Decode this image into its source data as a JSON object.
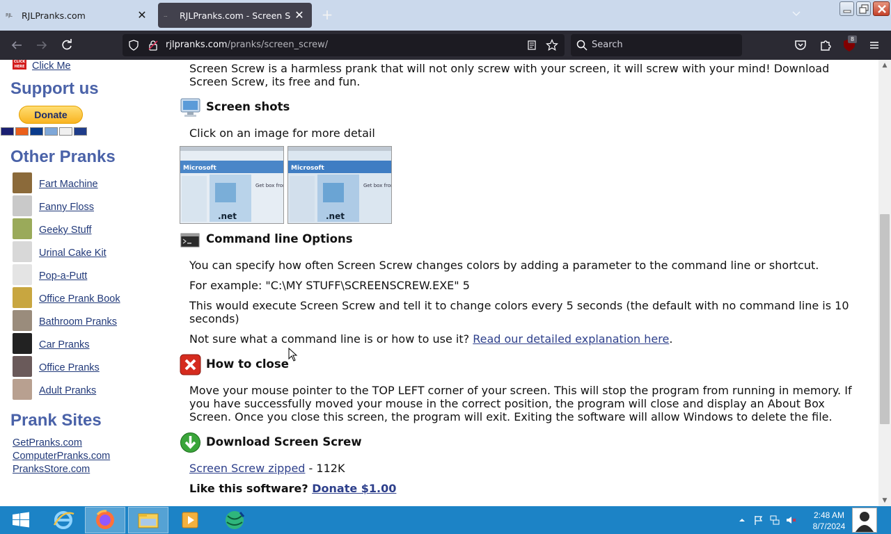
{
  "browser": {
    "tabs": [
      {
        "favicon_text": "RJL",
        "title": "RJLPranks.com"
      },
      {
        "favicon_text": "...",
        "title": "RJLPranks.com - Screen Screw"
      }
    ],
    "url_domain": "rjlpranks.com",
    "url_path": "/pranks/screen_screw/",
    "search_placeholder": "Search",
    "extension_badge": "8"
  },
  "sidebar": {
    "click_me_img_text": "CLICK HERE",
    "click_me": "Click Me",
    "support_heading": "Support us",
    "donate_label": "Donate",
    "other_pranks_heading": "Other Pranks",
    "pranks": [
      {
        "label": "Fart Machine",
        "color": "#8b6a3a"
      },
      {
        "label": "Fanny Floss",
        "color": "#c9c9c9"
      },
      {
        "label": "Geeky Stuff",
        "color": "#9aaa5a"
      },
      {
        "label": "Urinal Cake Kit",
        "color": "#d8d8d8"
      },
      {
        "label": "Pop-a-Putt",
        "color": "#e4e4e4"
      },
      {
        "label": "Office Prank Book",
        "color": "#c8a640"
      },
      {
        "label": "Bathroom Pranks",
        "color": "#9a8c7c"
      },
      {
        "label": "Car Pranks",
        "color": "#222222"
      },
      {
        "label": "Office Pranks",
        "color": "#6a5a5a"
      },
      {
        "label": "Adult Pranks",
        "color": "#b8a090"
      }
    ],
    "prank_sites_heading": "Prank Sites",
    "sites": [
      "GetPranks.com",
      "ComputerPranks.com",
      "PranksStore.com"
    ]
  },
  "main": {
    "intro": "Screen Screw is a harmless prank that will not only screw with your screen, it will screw with your mind! Download Screen Screw, its free and fun.",
    "screenshots_heading": "Screen shots",
    "screenshots_hint": "Click on an image for more detail",
    "cmd_heading": "Command line Options",
    "cmd_p1": "You can specify how often Screen Screw changes colors by adding a parameter to the command line or shortcut.",
    "cmd_p2": "For example: \"C:\\MY STUFF\\SCREENSCREW.EXE\" 5",
    "cmd_p3": "This would execute Screen Screw and tell it to change colors every 5 seconds (the default with no command line is 10 seconds)",
    "cmd_p4_prefix": "Not sure what a command line is or how to use it? ",
    "cmd_p4_link": "Read our detailed explanation here",
    "cmd_p4_suffix": ".",
    "close_heading": "How to close",
    "close_p": "Move your mouse pointer to the TOP LEFT corner of your screen. This will stop the program from running in memory. If you have successfully moved your mouse in the correct position, the program will close and display an About Box Screen. Once you close this screen, the program will exit. Exiting the software will allow Windows to delete the file.",
    "download_heading": "Download Screen Screw",
    "download_link": "Screen Screw zipped",
    "download_size": " - 112K",
    "like_text": "Like this software? ",
    "donate_link": "Donate $1.00",
    "screenshot_brand": "Microsoft",
    "screenshot_promo": "Get box from power users",
    "screenshot_net": ".net"
  },
  "taskbar": {
    "time": "2:48 AM",
    "date": "8/7/2024"
  },
  "colors": {
    "accent_blue": "#4a62a8",
    "link": "#223a7a",
    "taskbar": "#1c83c6"
  }
}
